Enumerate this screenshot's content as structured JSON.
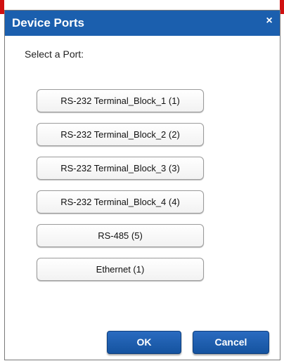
{
  "dialog": {
    "title": "Device Ports",
    "close_label": "×",
    "prompt": "Select a Port:"
  },
  "ports": [
    {
      "label": "RS-232 Terminal_Block_1 (1)"
    },
    {
      "label": "RS-232 Terminal_Block_2 (2)"
    },
    {
      "label": "RS-232 Terminal_Block_3 (3)"
    },
    {
      "label": "RS-232 Terminal_Block_4 (4)"
    },
    {
      "label": "RS-485  (5)"
    },
    {
      "label": "Ethernet  (1)"
    }
  ],
  "footer": {
    "ok_label": "OK",
    "cancel_label": "Cancel"
  },
  "colors": {
    "titlebar": "#1b5fae",
    "frame_accent": "#d01010",
    "primary_button": "#1b5fae"
  }
}
